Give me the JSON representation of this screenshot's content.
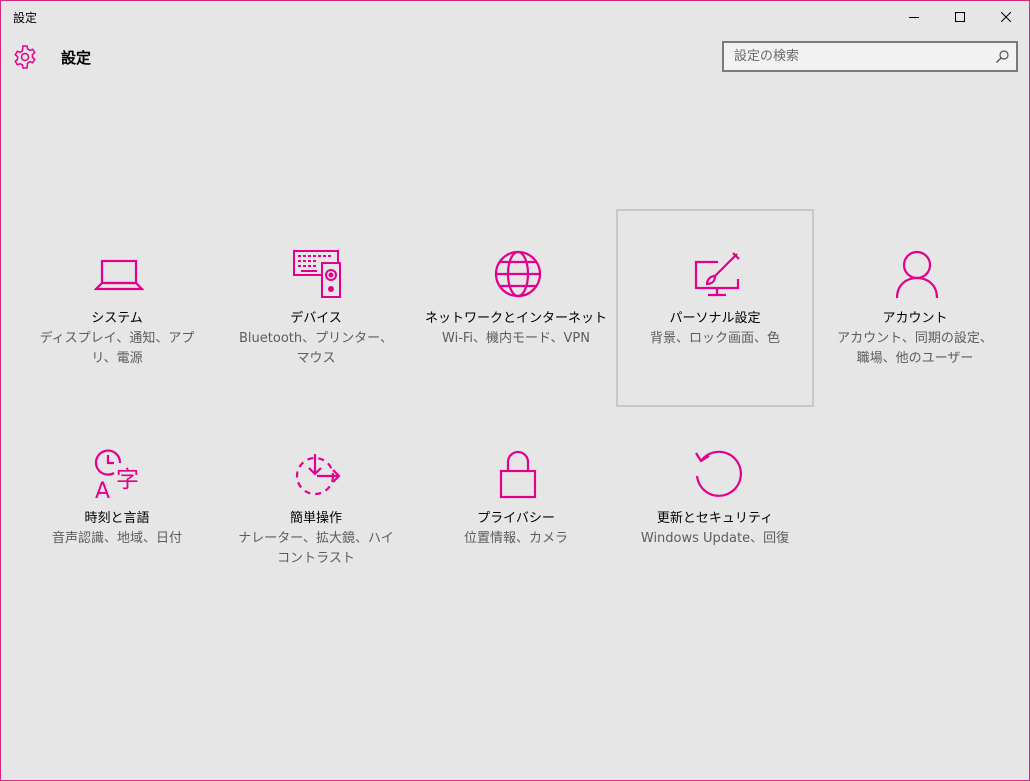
{
  "window": {
    "title": "設定"
  },
  "header": {
    "title": "設定",
    "icon": "gear-icon"
  },
  "search": {
    "placeholder": "設定の検索",
    "value": ""
  },
  "accent_color": "#e3008c",
  "tiles": [
    {
      "id": "system",
      "icon": "laptop-icon",
      "title": "システム",
      "desc": "ディスプレイ、通知、アプリ、電源"
    },
    {
      "id": "devices",
      "icon": "devices-icon",
      "title": "デバイス",
      "desc": "Bluetooth、プリンター、マウス"
    },
    {
      "id": "network",
      "icon": "globe-icon",
      "title": "ネットワークとインターネット",
      "desc": "Wi-Fi、機内モード、VPN"
    },
    {
      "id": "personalization",
      "icon": "paint-monitor-icon",
      "title": "パーソナル設定",
      "desc": "背景、ロック画面、色"
    },
    {
      "id": "accounts",
      "icon": "person-icon",
      "title": "アカウント",
      "desc": "アカウント、同期の設定、職場、他のユーザー"
    },
    {
      "id": "time-language",
      "icon": "time-language-icon",
      "title": "時刻と言語",
      "desc": "音声認識、地域、日付"
    },
    {
      "id": "ease-of-access",
      "icon": "ease-of-access-icon",
      "title": "簡単操作",
      "desc": "ナレーター、拡大鏡、ハイコントラスト"
    },
    {
      "id": "privacy",
      "icon": "lock-icon",
      "title": "プライバシー",
      "desc": "位置情報、カメラ"
    },
    {
      "id": "update-security",
      "icon": "refresh-icon",
      "title": "更新とセキュリティ",
      "desc": "Windows Update、回復"
    }
  ]
}
